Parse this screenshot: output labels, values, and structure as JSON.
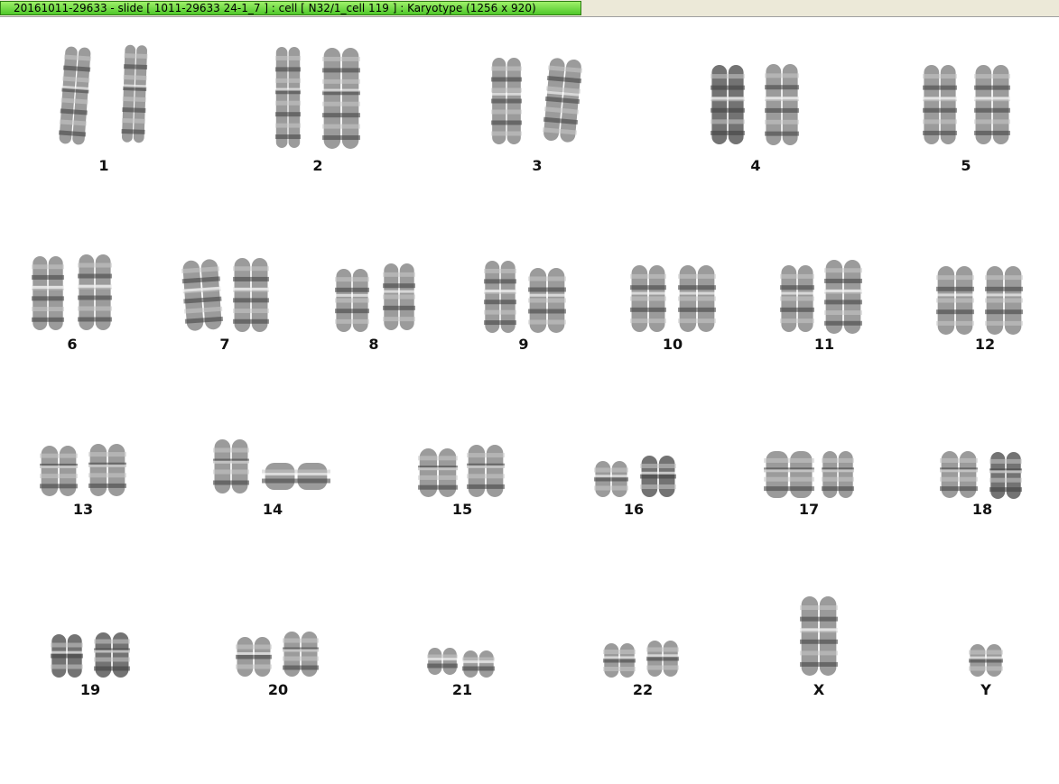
{
  "window": {
    "title": "20161011-29633 - slide [ 1011-29633 24-1_7 ] : cell [ N32/1_cell 119 ] : Karyotype  (1256 x 920)"
  },
  "karyotype": {
    "rows": [
      {
        "labels": [
          "1",
          "2",
          "3",
          "4",
          "5"
        ]
      },
      {
        "labels": [
          "6",
          "7",
          "8",
          "9",
          "10",
          "11",
          "12"
        ]
      },
      {
        "labels": [
          "13",
          "14",
          "15",
          "16",
          "17",
          "18"
        ]
      },
      {
        "labels": [
          "19",
          "20",
          "21",
          "22",
          "X",
          "Y"
        ]
      }
    ]
  }
}
